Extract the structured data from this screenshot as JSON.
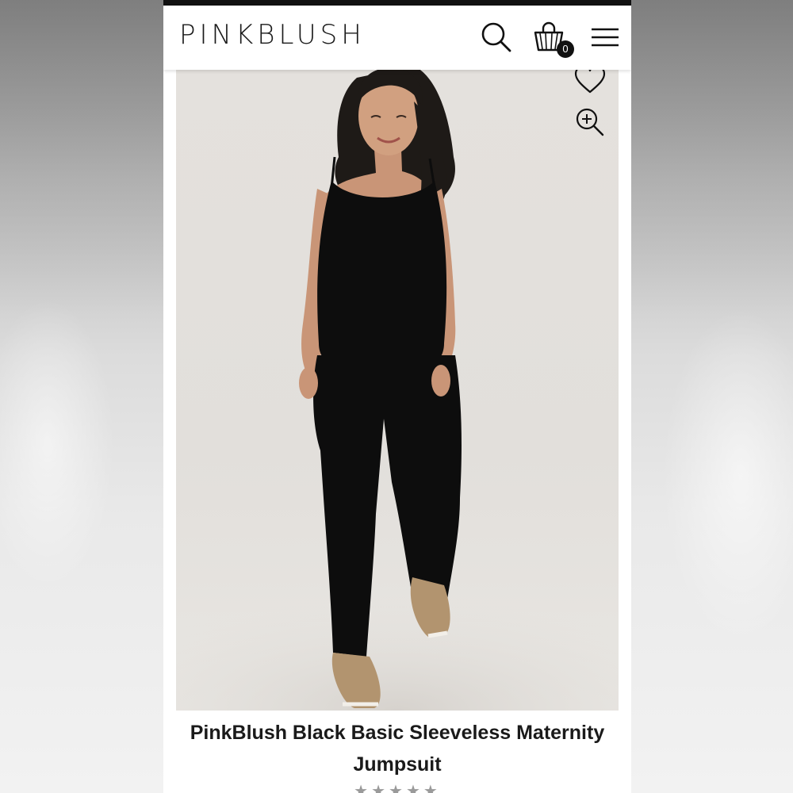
{
  "brand": {
    "logo_text": "PINKBLUSH"
  },
  "header": {
    "cart_count": "0",
    "icons": [
      "search-icon",
      "shopping-bag-icon",
      "hamburger-menu-icon"
    ]
  },
  "product": {
    "title": "PinkBlush Black Basic Sleeveless Maternity Jumpsuit",
    "image_icons": [
      "heart-icon",
      "zoom-in-icon"
    ],
    "rating_stars": "★★★★★"
  },
  "colors": {
    "text": "#1a1a1a",
    "garment": "#0d0d0d",
    "image_background": "#e3e0dc",
    "badge": "#111111"
  }
}
